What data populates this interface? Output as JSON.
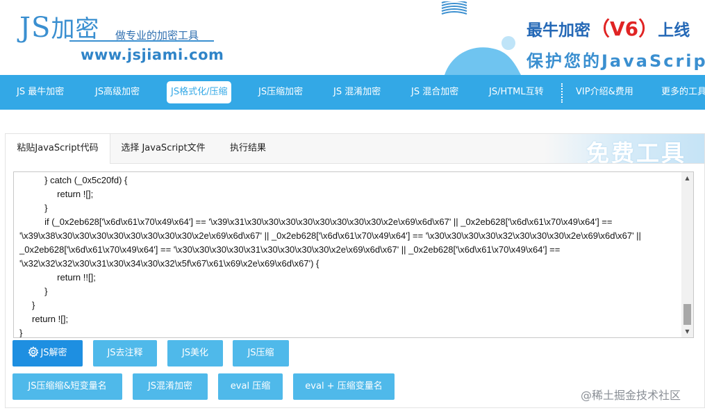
{
  "header": {
    "logo_js": "JS",
    "logo_cn": "加密",
    "slogan": "做专业的加密工具",
    "url": "www.jsjiami.com",
    "banner_line1_a": "最牛加密",
    "banner_line1_paren_open": "（",
    "banner_line1_v": "V6",
    "banner_line1_paren_close": "）",
    "banner_line1_b": "上线",
    "banner_line2": "保护您的JavaScript"
  },
  "nav": {
    "items": [
      {
        "label": "JS 最牛加密"
      },
      {
        "label": "JS高级加密"
      },
      {
        "label": "JS格式化/压缩"
      },
      {
        "label": "JS压缩加密"
      },
      {
        "label": "JS 混淆加密"
      },
      {
        "label": "JS 混合加密"
      },
      {
        "label": "JS/HTML互转"
      },
      {
        "label": "VIP介绍&费用"
      },
      {
        "label": "更多的工具"
      }
    ],
    "active_index": 2
  },
  "tabs": {
    "items": [
      {
        "label": "粘贴JavaScript代码"
      },
      {
        "label": "选择 JavaScript文件"
      },
      {
        "label": "执行结果"
      }
    ],
    "banner_text": "免费工具"
  },
  "code": {
    "lines": [
      "          } catch (_0x5c20fd) {",
      "               return ![];",
      "          }",
      "          if (_0x2eb628['\\x6d\\x61\\x70\\x49\\x64'] == '\\x39\\x31\\x30\\x30\\x30\\x30\\x30\\x30\\x30\\x30\\x2e\\x69\\x6d\\x67' || _0x2eb628['\\x6d\\x61\\x70\\x49\\x64'] ==",
      "'\\x39\\x38\\x30\\x30\\x30\\x30\\x30\\x30\\x30\\x30\\x2e\\x69\\x6d\\x67' || _0x2eb628['\\x6d\\x61\\x70\\x49\\x64'] == '\\x30\\x30\\x30\\x30\\x32\\x30\\x30\\x30\\x2e\\x69\\x6d\\x67' ||",
      "_0x2eb628['\\x6d\\x61\\x70\\x49\\x64'] == '\\x30\\x30\\x30\\x30\\x31\\x30\\x30\\x30\\x30\\x2e\\x69\\x6d\\x67' || _0x2eb628['\\x6d\\x61\\x70\\x49\\x64'] ==",
      "'\\x32\\x32\\x32\\x30\\x31\\x30\\x34\\x30\\x32\\x5f\\x67\\x61\\x69\\x2e\\x69\\x6d\\x67') {",
      "               return !![];",
      "          }",
      "     }",
      "     return ![];",
      "}"
    ]
  },
  "buttons": {
    "row1": [
      {
        "label": "JS解密"
      },
      {
        "label": "JS去注释"
      },
      {
        "label": "JS美化"
      },
      {
        "label": "JS压缩"
      }
    ],
    "row2": [
      {
        "label": "JS压缩缩&短变量名"
      },
      {
        "label": "JS混淆加密"
      },
      {
        "label": "eval 压缩"
      },
      {
        "label": "eval + 压缩变量名"
      }
    ]
  },
  "watermark": "@稀土掘金技术社区",
  "colors": {
    "nav_bg": "#33a8e6",
    "button_bg": "#4fb9ea",
    "button_primary_bg": "#1e8fe1",
    "banner_red": "#e02424",
    "brand_blue": "#2468b6"
  }
}
